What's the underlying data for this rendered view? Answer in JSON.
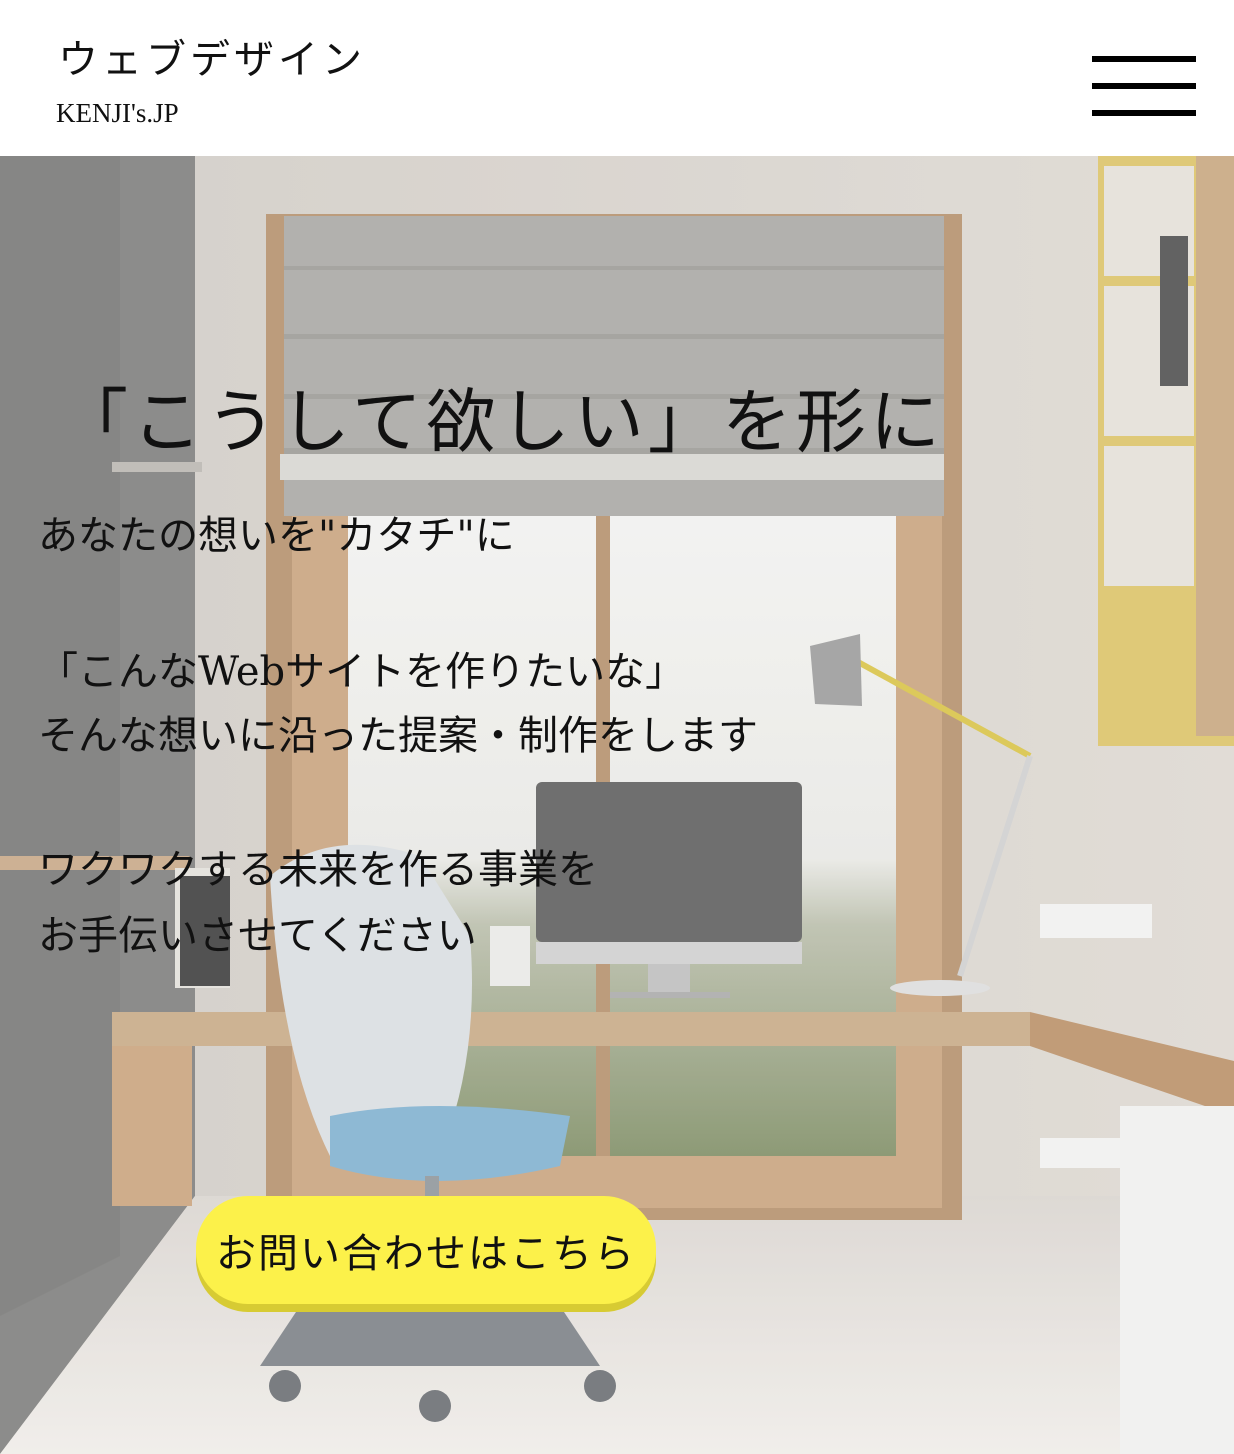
{
  "header": {
    "title": "ウェブデザイン",
    "subtitle": "KENJI's.JP",
    "menu_icon": "hamburger-menu-icon"
  },
  "hero": {
    "headline": "「こうして欲しい」を形に",
    "lines": [
      "あなたの想いを\"カタチ\"に",
      "「こんなWebサイトを作りたいな」",
      "そんな想いに沿った提案・制作をします",
      "ワクワクする未来を作る事業を",
      "お手伝いさせてください"
    ],
    "cta_label": "お問い合わせはこちら",
    "cta_color": "#fcf14a",
    "background": "home-office-photo"
  }
}
